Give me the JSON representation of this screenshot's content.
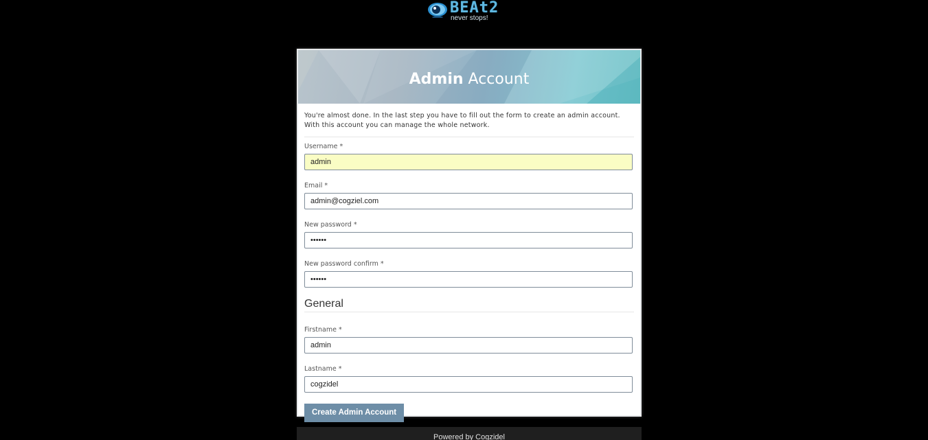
{
  "logo": {
    "brand": "BEAt2",
    "slogan": "never stops!"
  },
  "panel": {
    "title_bold": "Admin",
    "title_light": "Account",
    "intro": "You're almost done. In the last step you have to fill out the form to create an admin account. With this account you can manage the whole network."
  },
  "form": {
    "username": {
      "label": "Username *",
      "value": "admin"
    },
    "email": {
      "label": "Email *",
      "value": "admin@cogziel.com"
    },
    "password": {
      "label": "New password *",
      "value": "••••••"
    },
    "password_confirm": {
      "label": "New password confirm *",
      "value": "••••••"
    },
    "general_heading": "General",
    "firstname": {
      "label": "Firstname *",
      "value": "admin"
    },
    "lastname": {
      "label": "Lastname *",
      "value": "cogzidel"
    },
    "submit_label": "Create Admin Account"
  },
  "footer": {
    "text": "Powered by Cogzidel"
  },
  "colors": {
    "background": "#000000",
    "button": "#6e8ea7",
    "autofill": "#fafdc4",
    "brand": "#5fb8e0"
  }
}
